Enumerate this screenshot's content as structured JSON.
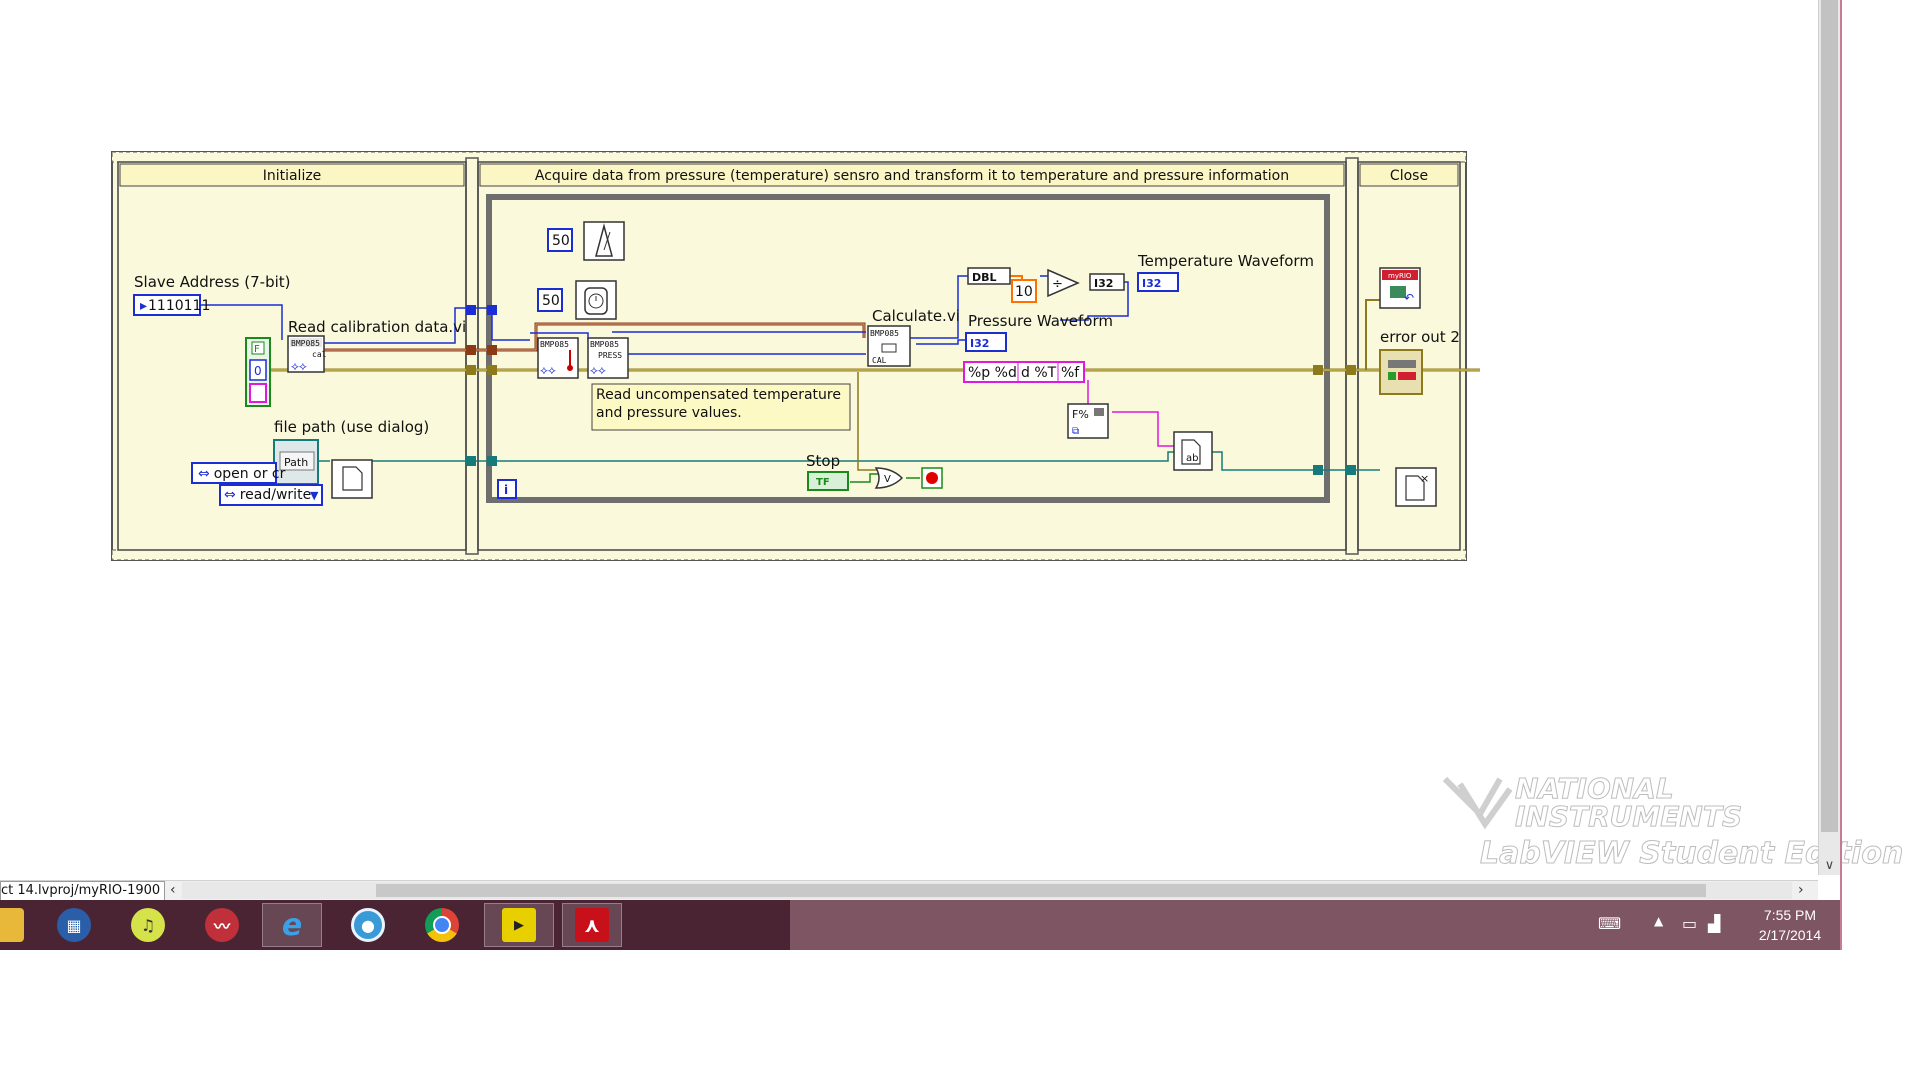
{
  "frames": {
    "initialize": "Initialize",
    "acquire": "Acquire data from pressure (temperature) sensro and transform it to temperature and pressure information",
    "close": "Close"
  },
  "labels": {
    "slave_address": "Slave Address (7-bit)",
    "slave_address_value": "1110111",
    "read_calibration": "Read calibration data.vi",
    "file_path": "file path (use dialog)",
    "path_icon_text": "Path",
    "open_or_create": "open or cr",
    "read_write": "read/write",
    "wait_ms_1": "50",
    "wait_ms_2": "50",
    "calculate": "Calculate.vi",
    "pressure_waveform": "Pressure Waveform",
    "temperature_waveform": "Temperature Waveform",
    "dbl": "DBL",
    "i32": "I32",
    "i32_indicator_1": "I32",
    "i32_indicator_2": "I32",
    "constant_10": "10",
    "format_string": "%p %d",
    "format_string_2": "d %T",
    "format_string_3": "%f",
    "comment": "Read uncompensated temperature and pressure values.",
    "stop": "Stop",
    "stop_tf": "TF",
    "loop_iteration": "i",
    "error_out": "error out 2",
    "myrio": "myRIO",
    "bmp_chip": "BMP085",
    "bmp_cal": "cal",
    "bmp_press": "PRESS",
    "bool_f": "F",
    "bool_zero": "0"
  },
  "statusbar": {
    "path": "ct 14.lvproj/myRIO-1900"
  },
  "watermark": {
    "line1": "NATIONAL",
    "line2": "INSTRUMENTS",
    "line3": "LabVIEW Student Edition"
  },
  "taskbar": {
    "apps": [
      "file-explorer-icon",
      "media-player-icon",
      "itunes-icon",
      "audio-editor-icon",
      "internet-explorer-icon",
      "dvd-icon",
      "chrome-icon",
      "labview-icon",
      "acrobat-icon"
    ],
    "time": "7:55 PM",
    "date": "2/17/2014"
  },
  "colors": {
    "frame_fill": "#fbf9dc",
    "header_fill": "#fbf6c4",
    "taskbar": "#7d5563",
    "wire_error": "#8c7a1c",
    "wire_refnum": "#177a7a",
    "wire_int": "#1b2ed3",
    "wire_string": "#e018e0",
    "wire_float": "#ff7000"
  }
}
